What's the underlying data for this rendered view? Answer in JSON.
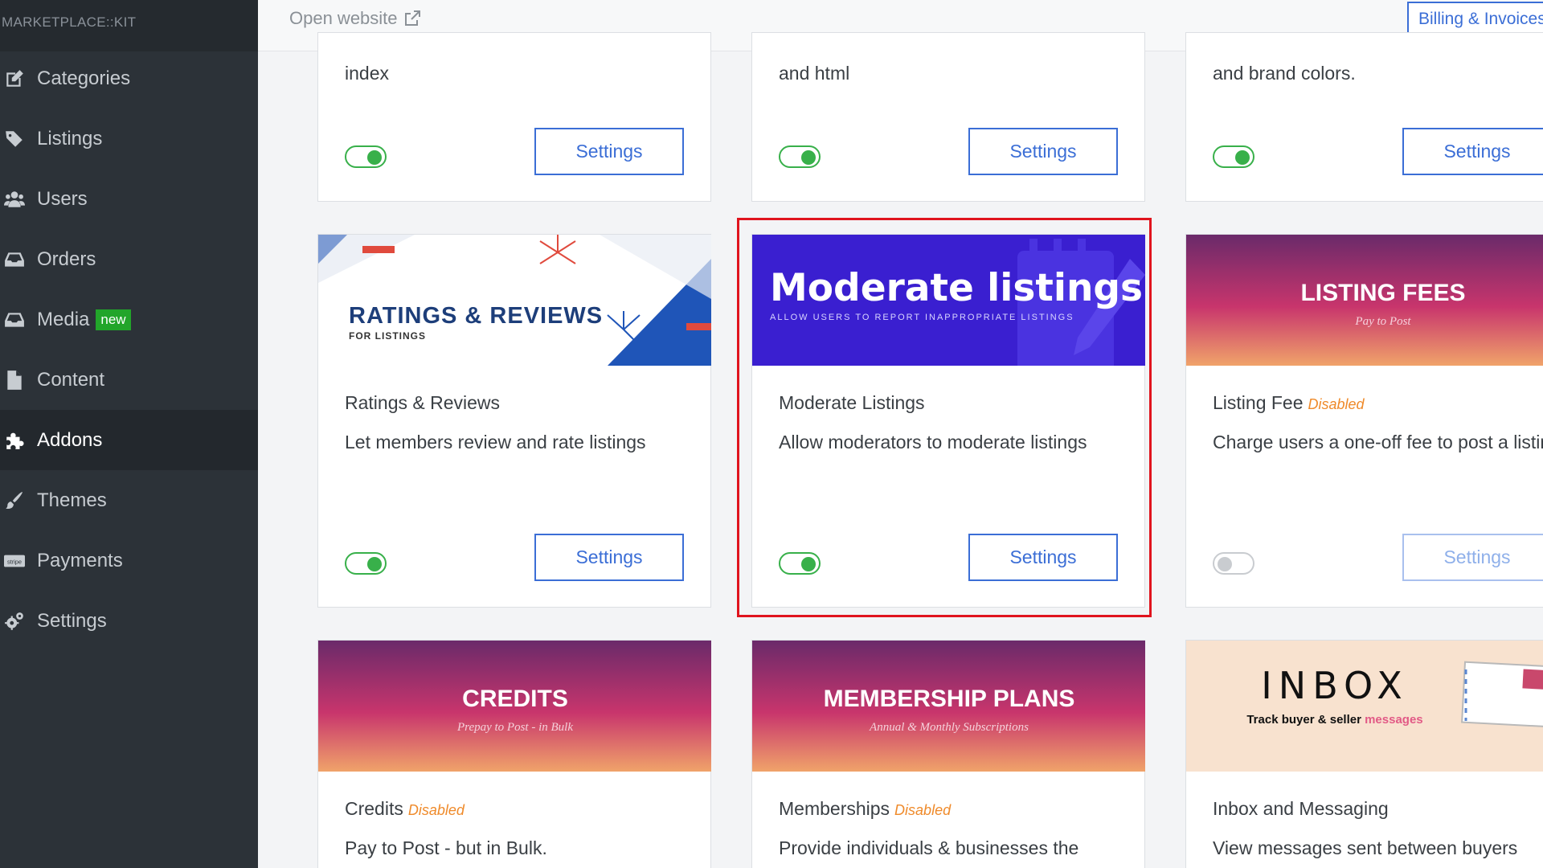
{
  "brand": "MARKETPLACE::KIT",
  "sidebar": {
    "items": [
      {
        "label": "Categories",
        "icon": "edit-icon"
      },
      {
        "label": "Listings",
        "icon": "tags-icon"
      },
      {
        "label": "Users",
        "icon": "users-icon"
      },
      {
        "label": "Orders",
        "icon": "inbox-icon"
      },
      {
        "label": "Media",
        "icon": "inbox-icon",
        "badge": "new"
      },
      {
        "label": "Content",
        "icon": "file-icon"
      },
      {
        "label": "Addons",
        "icon": "puzzle-icon",
        "active": true
      },
      {
        "label": "Themes",
        "icon": "brush-icon"
      },
      {
        "label": "Payments",
        "icon": "stripe-icon"
      },
      {
        "label": "Settings",
        "icon": "cogs-icon"
      }
    ]
  },
  "topbar": {
    "open_website": "Open website",
    "billing": "Billing & Invoices"
  },
  "cards": [
    {
      "desc_tail": "index",
      "enabled": true,
      "button": "Settings"
    },
    {
      "desc_tail": "and html",
      "enabled": true,
      "button": "Settings"
    },
    {
      "desc_tail": "and brand colors.",
      "enabled": true,
      "button": "Settings"
    },
    {
      "title": "Ratings & Reviews",
      "description": "Let members review and rate listings",
      "enabled": true,
      "button": "Settings",
      "banner": {
        "title": "RATINGS & REVIEWS",
        "subtitle": "FOR LISTINGS"
      }
    },
    {
      "title": "Moderate Listings",
      "description": "Allow moderators to moderate listings",
      "enabled": true,
      "button": "Settings",
      "banner": {
        "title": "Moderate listings",
        "subtitle": "ALLOW USERS TO REPORT INAPPROPRIATE LISTINGS"
      }
    },
    {
      "title": "Listing Fee",
      "status": "Disabled",
      "description": "Charge users a one-off fee to post a listing",
      "enabled": false,
      "button": "Settings",
      "banner": {
        "title": "LISTING FEES",
        "subtitle": "Pay to Post"
      }
    },
    {
      "title": "Credits",
      "status": "Disabled",
      "description": "Pay to Post - but in Bulk.",
      "banner": {
        "title": "CREDITS",
        "subtitle": "Prepay to Post - in Bulk"
      }
    },
    {
      "title": "Memberships",
      "status": "Disabled",
      "description": "Provide individuals & businesses the",
      "banner": {
        "title": "MEMBERSHIP PLANS",
        "subtitle": "Annual & Monthly Subscriptions"
      }
    },
    {
      "title": "Inbox and Messaging",
      "description": "View messages sent between buyers",
      "banner": {
        "title": "INBOX",
        "subtitle_a": "Track buyer & seller ",
        "subtitle_b": "messages"
      }
    }
  ],
  "colors": {
    "sidebar_bg": "#2c3238",
    "accent": "#3b6ed6",
    "toggle_on": "#38b04a",
    "disabled_text": "#ef8a2a",
    "highlight": "#e0141e",
    "new_badge": "#22a52a",
    "moderate_banner": "#3a1fd0"
  }
}
